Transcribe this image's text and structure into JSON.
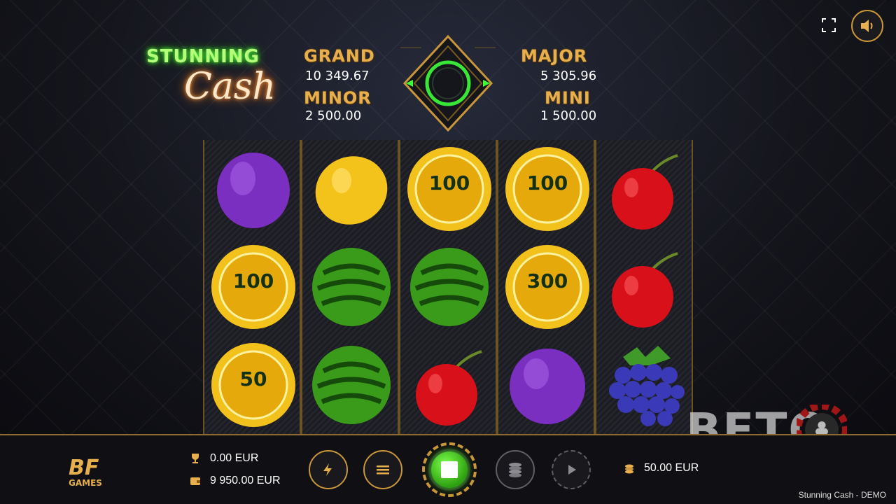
{
  "game": {
    "logo_top": "STUNNING",
    "logo_script": "Cash",
    "footer_title": "Stunning Cash - DEMO"
  },
  "jackpots": {
    "grand": {
      "label": "GRAND",
      "value": "10 349.67"
    },
    "major": {
      "label": "MAJOR",
      "value": "5 305.96"
    },
    "minor": {
      "label": "MINOR",
      "value": "2 500.00"
    },
    "mini": {
      "label": "MINI",
      "value": "1 500.00"
    }
  },
  "reels": [
    [
      {
        "symbol": "plum"
      },
      {
        "symbol": "coin",
        "value": "100"
      },
      {
        "symbol": "coin",
        "value": "50"
      }
    ],
    [
      {
        "symbol": "lemon"
      },
      {
        "symbol": "watermelon"
      },
      {
        "symbol": "watermelon"
      }
    ],
    [
      {
        "symbol": "coin",
        "value": "100"
      },
      {
        "symbol": "watermelon"
      },
      {
        "symbol": "cherry"
      }
    ],
    [
      {
        "symbol": "coin",
        "value": "100"
      },
      {
        "symbol": "coin",
        "value": "300"
      },
      {
        "symbol": "plum"
      }
    ],
    [
      {
        "symbol": "cherry"
      },
      {
        "symbol": "cherry"
      },
      {
        "symbol": "grapes"
      }
    ]
  ],
  "bottom": {
    "brand": "BF GAMES",
    "win": "0.00 EUR",
    "balance": "9 950.00 EUR",
    "bet": "50.00 EUR"
  },
  "watermark": {
    "text": "BETO"
  },
  "colors": {
    "accent_gold": "#c9963a",
    "spin_green": "#2ea010",
    "neon_green": "#4cff3a"
  },
  "icons": {
    "fullscreen": "fullscreen-icon",
    "sound": "speaker-icon",
    "turbo": "lightning-icon",
    "menu": "hamburger-icon",
    "bet": "coin-stack-icon",
    "autoplay": "autoplay-icon",
    "win": "trophy-icon",
    "balance": "wallet-icon"
  }
}
